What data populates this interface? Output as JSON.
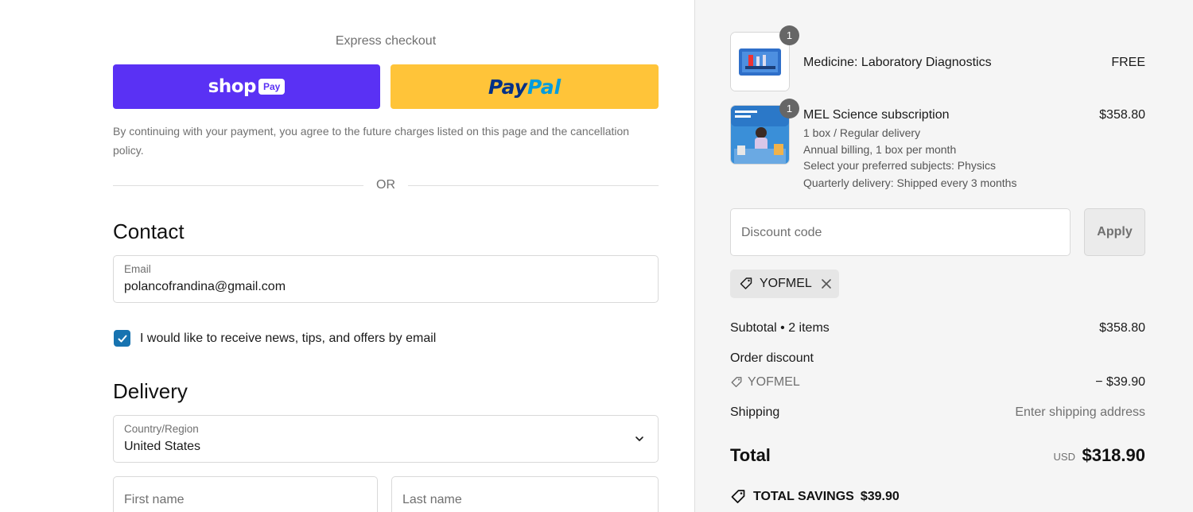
{
  "express": {
    "title": "Express checkout",
    "shop_label": "shop",
    "shop_pay_label": "Pay",
    "paypal_part1": "Pay",
    "paypal_part2": "Pal"
  },
  "consent_text": "By continuing with your payment, you agree to the future charges listed on this page and the cancellation policy.",
  "or_text": "OR",
  "contact": {
    "heading": "Contact",
    "email_label": "Email",
    "email_value": "polancofrandina@gmail.com",
    "newsletter_checked": true,
    "newsletter_label": "I would like to receive news, tips, and offers by email"
  },
  "delivery": {
    "heading": "Delivery",
    "country_label": "Country/Region",
    "country_value": "United States",
    "first_name_placeholder": "First name",
    "last_name_placeholder": "Last name"
  },
  "order": {
    "items": [
      {
        "quantity": "1",
        "title": "Medicine: Laboratory Diagnostics",
        "price": "FREE",
        "details": []
      },
      {
        "quantity": "1",
        "title": "MEL Science subscription",
        "price": "$358.80",
        "details": [
          "1 box / Regular delivery",
          "Annual billing, 1 box per month",
          "Select your preferred subjects: Physics",
          "Quarterly delivery: Shipped every 3 months"
        ]
      }
    ],
    "discount_placeholder": "Discount code",
    "apply_label": "Apply",
    "applied_code": "YOFMEL",
    "subtotal_label": "Subtotal • 2 items",
    "subtotal_value": "$358.80",
    "order_discount_label": "Order discount",
    "order_discount_code": "YOFMEL",
    "order_discount_value": "− $39.90",
    "shipping_label": "Shipping",
    "shipping_value": "Enter shipping address",
    "total_label": "Total",
    "total_currency": "USD",
    "total_value": "$318.90",
    "savings_label": "TOTAL SAVINGS",
    "savings_value": "$39.90"
  },
  "colors": {
    "shop_pay": "#5a31f4",
    "paypal": "#ffc439",
    "checkbox": "#1773b0",
    "sidebar_bg": "#f5f5f5"
  }
}
